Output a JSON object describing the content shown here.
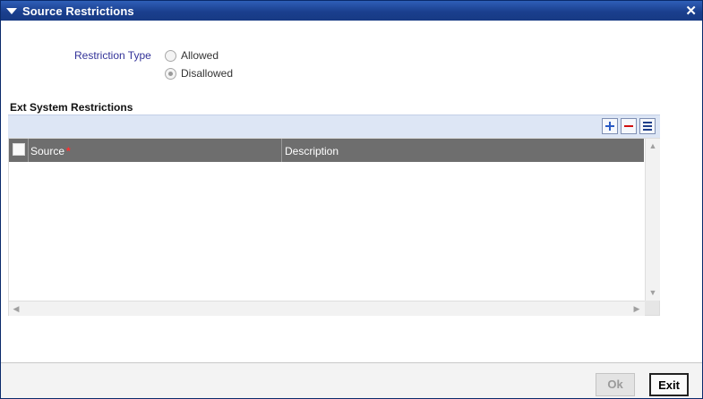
{
  "window": {
    "title": "Source Restrictions",
    "close_icon": "close-icon"
  },
  "restriction": {
    "label": "Restriction Type",
    "options": [
      {
        "label": "Allowed",
        "selected": false
      },
      {
        "label": "Disallowed",
        "selected": true
      }
    ]
  },
  "ext_system": {
    "section_title": "Ext System Restrictions",
    "toolbar": {
      "add_icon": "plus-icon",
      "delete_icon": "minus-icon",
      "view_icon": "list-view-icon"
    },
    "columns": [
      {
        "label": "Source",
        "required_mark": "*"
      },
      {
        "label": "Description"
      }
    ],
    "rows": []
  },
  "footer": {
    "ok_label": "Ok",
    "exit_label": "Exit"
  },
  "colors": {
    "title_bar": "#1a3f8e",
    "label_accent": "#333399",
    "grid_header": "#6e6e6e",
    "required": "#ff3030"
  }
}
